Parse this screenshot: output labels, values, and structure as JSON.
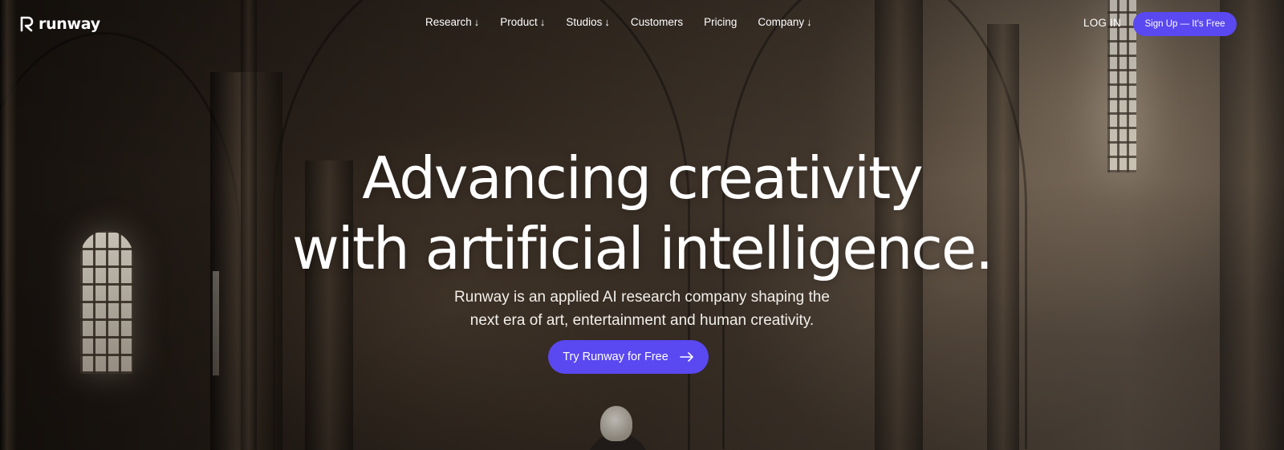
{
  "brand": {
    "name": "runway",
    "icon": "runway-logo-icon"
  },
  "nav": {
    "items": [
      {
        "label": "Research",
        "arrow": "↓"
      },
      {
        "label": "Product",
        "arrow": "↓"
      },
      {
        "label": "Studios",
        "arrow": "↓"
      },
      {
        "label": "Customers",
        "arrow": ""
      },
      {
        "label": "Pricing",
        "arrow": ""
      },
      {
        "label": "Company",
        "arrow": "↓"
      }
    ],
    "login_label": "LOG IN",
    "signup_label": "Sign Up — It's Free"
  },
  "hero": {
    "title_line1": "Advancing creativity",
    "title_line2": "with artificial intelligence.",
    "subtitle_line1": "Runway is an applied AI research company shaping the",
    "subtitle_line2": "next era of art, entertainment and human creativity.",
    "cta_label": "Try Runway for Free",
    "cta_icon": "arrow-right-icon"
  },
  "colors": {
    "accent": "#5a48f0",
    "text": "#ffffff"
  }
}
